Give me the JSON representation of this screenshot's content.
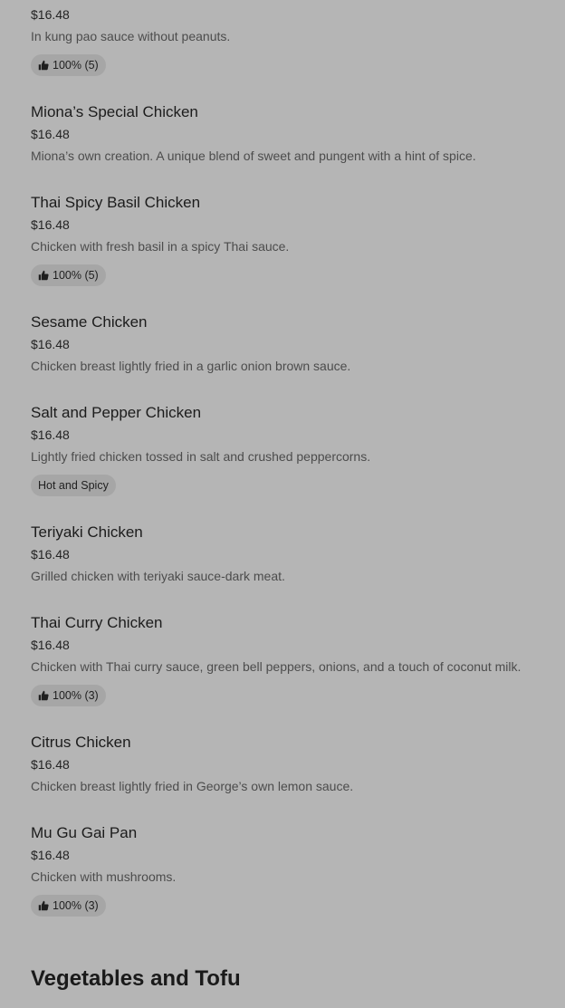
{
  "items": [
    {
      "name": "",
      "price": "$16.48",
      "desc": "In kung pao sauce without peanuts.",
      "badge": "100% (5)"
    },
    {
      "name": "Miona’s Special Chicken",
      "price": "$16.48",
      "desc": "Miona’s own creation. A unique blend of sweet and pungent with a hint of spice."
    },
    {
      "name": "Thai Spicy Basil Chicken",
      "price": "$16.48",
      "desc": "Chicken with fresh basil in a spicy Thai sauce.",
      "badge": "100% (5)"
    },
    {
      "name": "Sesame Chicken",
      "price": "$16.48",
      "desc": "Chicken breast lightly fried in a garlic onion brown sauce."
    },
    {
      "name": "Salt and Pepper Chicken",
      "price": "$16.48",
      "desc": "Lightly fried chicken tossed in salt and crushed peppercorns.",
      "tag": "Hot and Spicy"
    },
    {
      "name": "Teriyaki Chicken",
      "price": "$16.48",
      "desc": "Grilled chicken with teriyaki sauce-dark meat."
    },
    {
      "name": "Thai Curry Chicken",
      "price": "$16.48",
      "desc": "Chicken with Thai curry sauce, green bell peppers, onions, and a touch of coconut milk.",
      "badge": "100% (3)"
    },
    {
      "name": "Citrus Chicken",
      "price": "$16.48",
      "desc": "Chicken breast lightly fried in George’s own lemon sauce."
    },
    {
      "name": "Mu Gu Gai Pan",
      "price": "$16.48",
      "desc": "Chicken with mushrooms.",
      "badge": "100% (3)"
    }
  ],
  "section": {
    "title": "Vegetables and Tofu"
  },
  "icons": {
    "rating": "thumbs-up-icon"
  }
}
